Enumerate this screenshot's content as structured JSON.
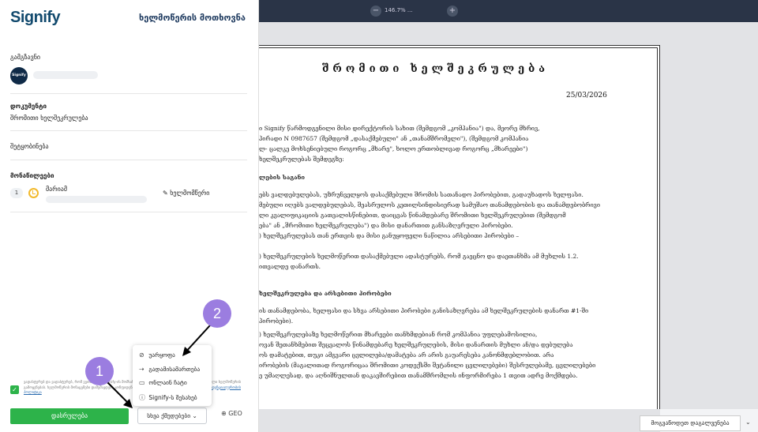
{
  "panel": {
    "logo": "Signify",
    "title": "ხელმოწერის მოთხოვნა",
    "sender_label": "გამგზავნი",
    "sender_avatar": "Signify",
    "document_label": "დოკუმენტი",
    "document_name": "შრომითი ხელშეკრულება",
    "message_label": "შეტყობინება",
    "participants_label": "მონაწილეები",
    "participant": {
      "order": "1",
      "name": "მარიამ",
      "role": "ხელმომწერი"
    },
    "legal_text": "ვადასტურებ და ვადასტურებ, რომ ვეთანხმები Signify-ის მომსახურების პირობებს და ვეთანხმები ელექტრონული ხელმოწერის გამოყენებას. ხელმოწერის მონაცემები დამუშავდება კონფიდენციალურობის პოლიტიკის შესაბამისად. ",
    "legal_link": "კონფიდენციალურობის პოლიტიკა",
    "sign_button": "დასრულება",
    "other_actions_button": "სხვა ქმედებები",
    "language": "GEO"
  },
  "menu": {
    "items": [
      {
        "icon": "cancel-icon",
        "glyph": "⊘",
        "label": "უარყოფა"
      },
      {
        "icon": "delegate-icon",
        "glyph": "⇢",
        "label": "გადამისამართება"
      },
      {
        "icon": "chat-icon",
        "glyph": "▭",
        "label": "ონლაინ ჩატი"
      },
      {
        "icon": "info-icon",
        "glyph": "ⓘ",
        "label": "Signify-ს შესახებ"
      }
    ]
  },
  "steps": [
    "1",
    "2"
  ],
  "toolbar": {
    "zoom": "146.7% ...",
    "minus": "−",
    "plus": "+"
  },
  "document": {
    "title": "შრომითი ხელშეკრულება",
    "date": "25/03/2026",
    "lines": [
      {
        "text": "ი Signify წარმოდგენილი მისი დირექტორის სახით (შემდგომ „კომპანია\") და, მეორე მხრივ,",
        "bold": false
      },
      {
        "text": "            პირადი N  0987657              (შემდგომ „დასაქმებული\" ან „თანამშრომელი\"), (შემდგომ კომპანია",
        "bold": false
      },
      {
        "text": "ლ- ცალკე მოხსენიებული როგორც „მხარე\", ხოლო ერთობლივად როგორც „მხარეები\")",
        "bold": false
      },
      {
        "text": "ხელშეკრულებას შემდეგზე:",
        "bold": false
      },
      {
        "text": "ლების საგანი",
        "bold": true
      },
      {
        "text": "ებს ვალდებულებას, უზრუნველყოს დასაქმებული შრომის სათანადო პირობებით, გადაუხადოს ხელფასი.",
        "bold": false
      },
      {
        "text": "მებული იღებს ვალდებულებას, შეასრულოს კეთილსინდისიერად სამუშაო თანამდებობის და თანამდებობრივი",
        "bold": false
      },
      {
        "text": "ლი კვალიფიკაციის გათვალისწინებით, დაიცვას წინამდებარე შრომითი ხელშეკრულებით (შემდგომ",
        "bold": false
      },
      {
        "text": "ება\" ან „შრომითი ხელშეკრულება\") და მისი დანართით  განსაზღვრული პირობები.",
        "bold": false
      },
      {
        "text": ") ხელშეკრულებას თან ერთვის და მისი განუყოფელი ნაწილია არსებითი პირობები –",
        "bold": false
      },
      {
        "text": ") ხელშეკრულების ხელმოწერით დასაქმებული ადასტურებს, რომ გაეცნო და დაეთანხმა ამ მუხლის 1.2.",
        "bold": false
      },
      {
        "text": "ითვალდე დანართს.",
        "bold": false
      },
      {
        "text": "ხელშეკრულება და არსებითი პირობები",
        "bold": true
      },
      {
        "text": "ის თანამდებობა, ხელფასი და სხვა არსებითი პირობები განისაზღვრება ამ ხელშეკრულების დანართ #1-ში",
        "bold": false
      },
      {
        "text": "პირობები).",
        "bold": false
      },
      {
        "text": ") ხელშეკრულებაზე ხელმოწერით მხარეები თანხმდებიან რომ კომპანია უფლებამოსილია,",
        "bold": false
      },
      {
        "text": "ოვან შეთანხმებით შეცვალოს წინამდებარე ხელშეკრულების, მისი დანართის  მუხლი ან/და დებულება",
        "bold": false
      },
      {
        "text": "ოს დამატებით, თუკი ამგვარი ცვლილება/დამატება არ არის გაუარესება კანონმდებლობით. არა",
        "bold": false
      },
      {
        "text": "ირობების (მაგალითად როგორიცაა შრომითი კოდექსში შეტანილი ცვლილებები) შესრულებამე, ცვლილებები",
        "bold": false
      },
      {
        "text": "ე უმაღლესად, და აღნიშნულთან დაკავშირებით თანამშრომლის ინფორმირება 1 თვით ადრე მოქმდება.",
        "bold": false
      }
    ]
  },
  "feedback_button": "მოგვაწოდეთ დაგალვენება"
}
